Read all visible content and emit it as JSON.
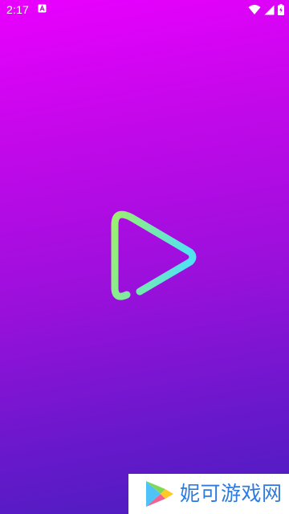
{
  "status_bar": {
    "time": "2:17",
    "icons": [
      "app-notification-icon",
      "wifi-icon",
      "signal-icon",
      "battery-charging-icon"
    ]
  },
  "splash": {
    "logo_icon": "play-icon",
    "background_colors": [
      "#ea00ff",
      "#4a1ebf"
    ],
    "logo_gradient": [
      "#9bef6e",
      "#52e3f0"
    ]
  },
  "watermark": {
    "text": "妮可游戏网",
    "icon": "google-play-icon",
    "text_color": "#2d7be0"
  }
}
